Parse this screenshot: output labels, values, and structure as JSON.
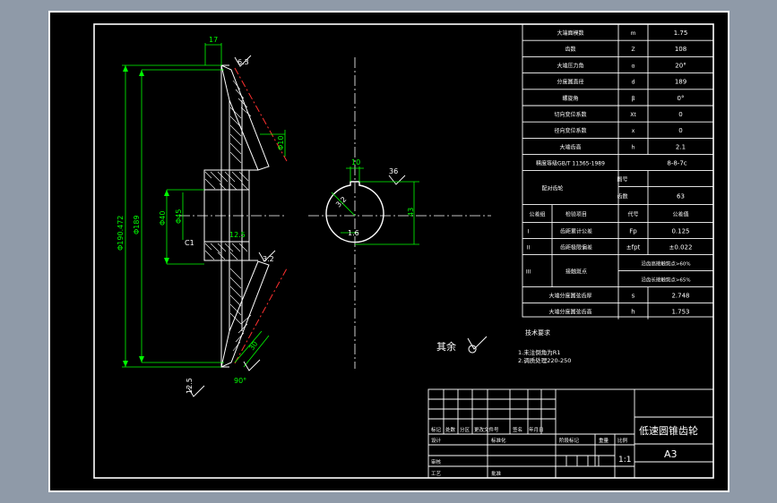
{
  "colors": {
    "background": "#8f9aa8",
    "sheet": "#000000",
    "line": "#ffffff",
    "dim": "#00ff00",
    "hidden": "#ff3030",
    "accent": "#ffff00"
  },
  "drawing": {
    "dims": {
      "d17": "17",
      "tip_od": "Φ190.472",
      "pitch_d": "Φ189",
      "bore": "Φ40",
      "hub": "Φ45",
      "r10": "Φ10",
      "c1": "C1",
      "r125": "12.5",
      "r32": "32",
      "d10": "10",
      "d36": "36",
      "d43": "43",
      "d16": "16",
      "d30": "30",
      "f16": "1.6",
      "f32": "3.2",
      "f63": "6.3",
      "f125": "12.5",
      "ang": "90°"
    }
  },
  "param_table": {
    "rows": [
      {
        "name": "大端面模数",
        "sym": "m",
        "val": "1.75"
      },
      {
        "name": "齿数",
        "sym": "Z",
        "val": "108"
      },
      {
        "name": "大端压力角",
        "sym": "α",
        "val": "20°"
      },
      {
        "name": "分度圆直径",
        "sym": "d",
        "val": "189"
      },
      {
        "name": "螺旋角",
        "sym": "β",
        "val": "0°"
      },
      {
        "name": "切向变位系数",
        "sym": "Xt",
        "val": "0"
      },
      {
        "name": "径向变位系数",
        "sym": "x",
        "val": "0"
      },
      {
        "name": "大端齿高",
        "sym": "h",
        "val": "2.1"
      }
    ],
    "accuracy_label": "精度等级GB/T 11365-1989",
    "accuracy_value": "8-8-7c",
    "pair_label": "配对齿轮",
    "pair_rows": [
      {
        "k": "图号",
        "v": ""
      },
      {
        "k": "齿数",
        "v": "63"
      }
    ],
    "tol_header": {
      "a": "公差组",
      "b": "检验项目",
      "c": "代号",
      "d": "公差值"
    },
    "tol_rows": [
      {
        "grp": "I",
        "item": "齿距累计公差",
        "sym": "Fp",
        "val": "0.125"
      },
      {
        "grp": "II",
        "item": "齿距极限偏差",
        "sym": "±fpt",
        "val": "±0.022"
      }
    ],
    "tol3": {
      "grp": "III",
      "item": "接触斑点",
      "r1": "沿齿高接触斑点>60%",
      "r2": "沿齿长接触斑点>65%"
    },
    "tail_rows": [
      {
        "name": "大端分度圆弦齿厚",
        "sym": "s",
        "val": "2.748"
      },
      {
        "name": "大端分度圆弦齿高",
        "sym": "h",
        "val": "1.753"
      }
    ]
  },
  "notes": {
    "rough": "其余",
    "rough_val": "6.3",
    "title": "技术要求",
    "items": [
      "1.未注倒角为R1",
      "2.调质处理220-250"
    ]
  },
  "title_block": {
    "part_name": "低速圆锥齿轮",
    "sheet": "A3",
    "scale": "1:1",
    "col_labels": [
      "标记",
      "处数",
      "分区",
      "更改文件号",
      "签名",
      "年月日"
    ],
    "role_design": "设计",
    "role_std": "标准化",
    "role_check": "审核",
    "role_proc": "工艺",
    "role_approve": "批准",
    "stage_mark": "阶段标记",
    "weight": "重量",
    "ratio": "比例"
  }
}
